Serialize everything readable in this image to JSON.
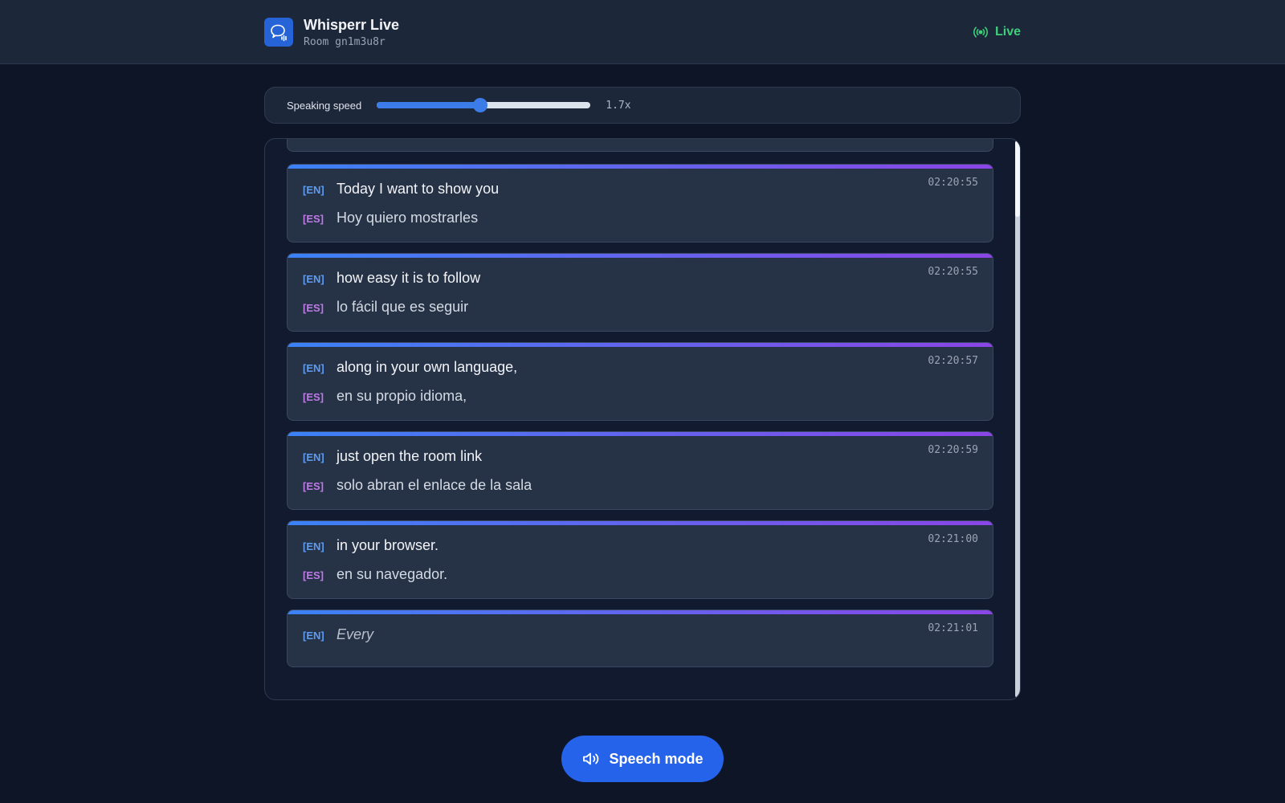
{
  "header": {
    "title": "Whisperr Live",
    "room": "Room gn1m3u8r",
    "status": "Live",
    "status_color": "#3ecf7a",
    "logo_icon": "chat-bubble-soundwave-icon"
  },
  "speed": {
    "label": "Speaking speed",
    "value_text": "1.7x",
    "fraction": 0.485
  },
  "transcript": {
    "entries": [
      {
        "time": "02:20:55",
        "en_tag": "[EN]",
        "en": "Today I want to show you",
        "es_tag": "[ES]",
        "es": "Hoy quiero mostrarles"
      },
      {
        "time": "02:20:55",
        "en_tag": "[EN]",
        "en": "how easy it is to follow",
        "es_tag": "[ES]",
        "es": "lo fácil que es seguir"
      },
      {
        "time": "02:20:57",
        "en_tag": "[EN]",
        "en": "along in your own language,",
        "es_tag": "[ES]",
        "es": "en su propio idioma,"
      },
      {
        "time": "02:20:59",
        "en_tag": "[EN]",
        "en": "just open the room link",
        "es_tag": "[ES]",
        "es": "solo abran el enlace de la sala"
      },
      {
        "time": "02:21:00",
        "en_tag": "[EN]",
        "en": "in your browser.",
        "es_tag": "[ES]",
        "es": "en su navegador."
      },
      {
        "time": "02:21:01",
        "en_tag": "[EN]",
        "en": "Every"
      }
    ]
  },
  "speech_button": {
    "label": "Speech mode",
    "icon": "speaker-icon",
    "color": "#2563eb"
  },
  "colors": {
    "en_tag": "#5d9cf2",
    "es_tag": "#c07ae8",
    "accent_start": "#3b82f6",
    "accent_end": "#8b45e6"
  }
}
